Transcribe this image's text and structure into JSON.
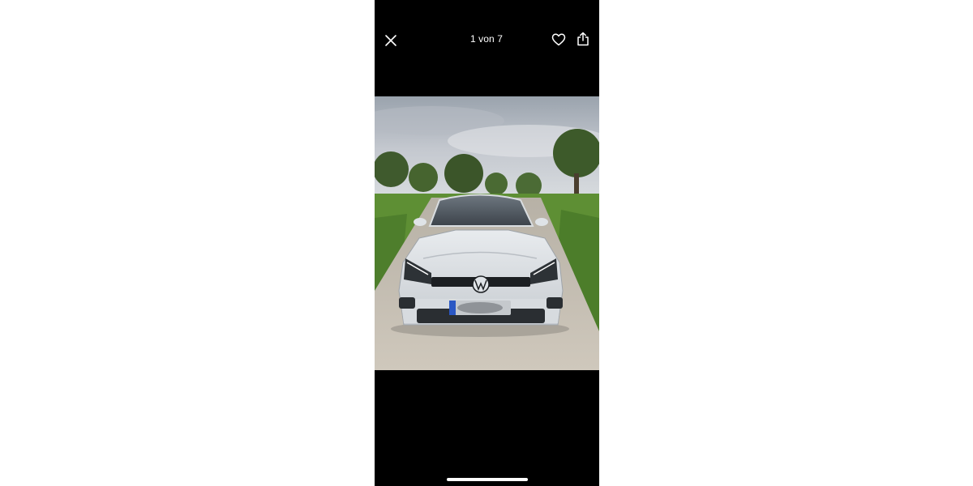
{
  "viewer": {
    "counter": "1 von 7",
    "close_icon": "close-icon",
    "favorite_icon": "heart-icon",
    "share_icon": "share-icon"
  },
  "photo": {
    "subject": "car-photo",
    "plate_blurred": true
  },
  "colors": {
    "background": "#000000",
    "page": "#ffffff",
    "icon": "#ffffff"
  }
}
